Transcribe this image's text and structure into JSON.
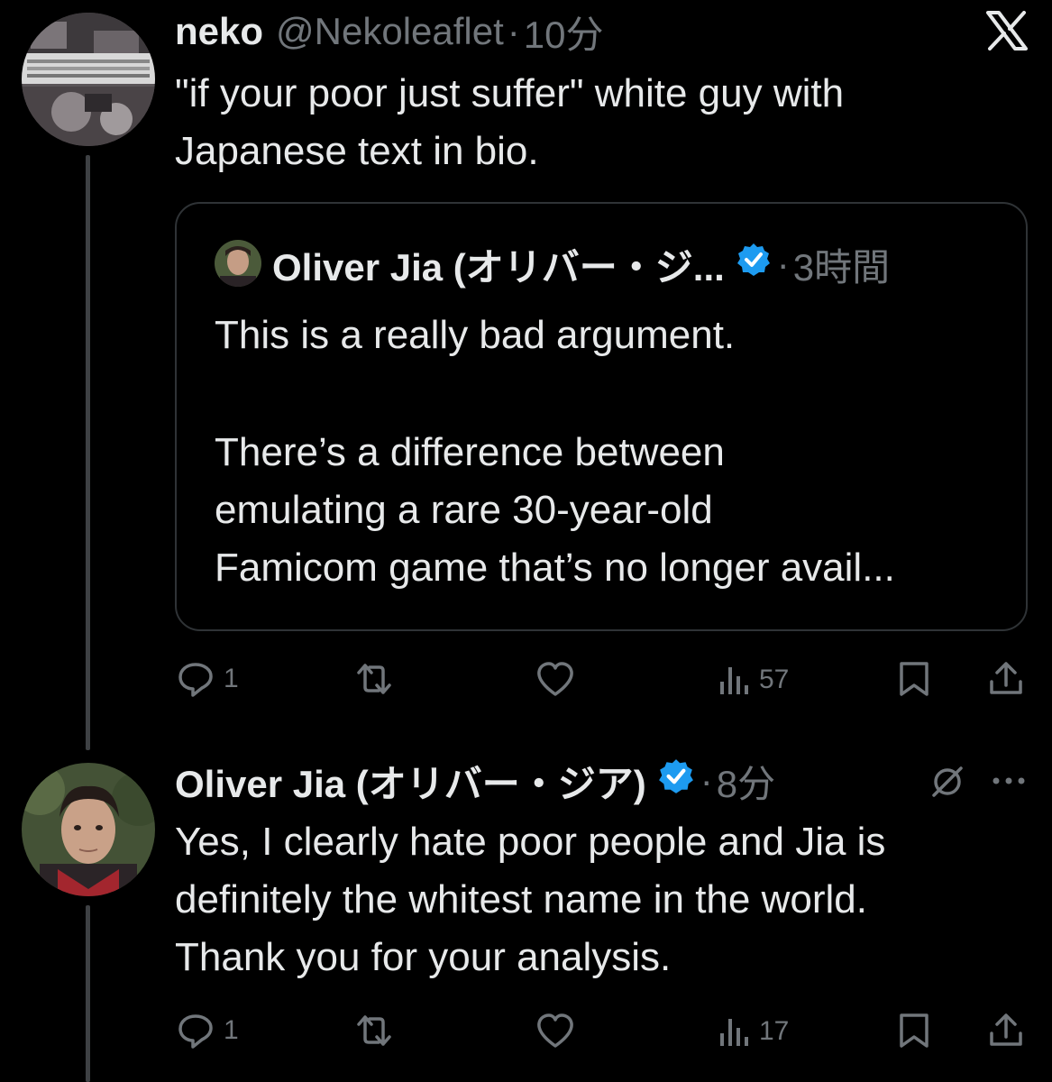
{
  "app": {
    "logo": "x-logo-icon"
  },
  "tweet1": {
    "author_name": "neko",
    "handle": "@Nekoleaflet",
    "separator": "·",
    "time": "10分",
    "text_line1": "\"if your poor just suffer\" white guy with",
    "text_line2": "Japanese text in bio.",
    "quote": {
      "author_name": "Oliver Jia (オリバー・ジ...",
      "separator": "·",
      "time": "3時間",
      "line1": "This is a really bad argument.",
      "line2": "There’s a difference between",
      "line3": "emulating a rare 30-year-old",
      "line4": "Famicom game that’s no longer avail..."
    },
    "actions": {
      "replies": "1",
      "views": "57"
    }
  },
  "tweet2": {
    "author_name": "Oliver Jia (オリバー・ジア)",
    "separator": "·",
    "time": "8分",
    "text_line1": "Yes, I clearly hate poor people and Jia is",
    "text_line2": "definitely the whitest name in the world.",
    "text_line3": "Thank you for your analysis.",
    "actions": {
      "replies": "1",
      "views": "17"
    }
  },
  "colors": {
    "background": "#000000",
    "text": "#e7e9ea",
    "muted": "#71767b",
    "verified": "#1d9bf0",
    "border": "#2f3336"
  }
}
